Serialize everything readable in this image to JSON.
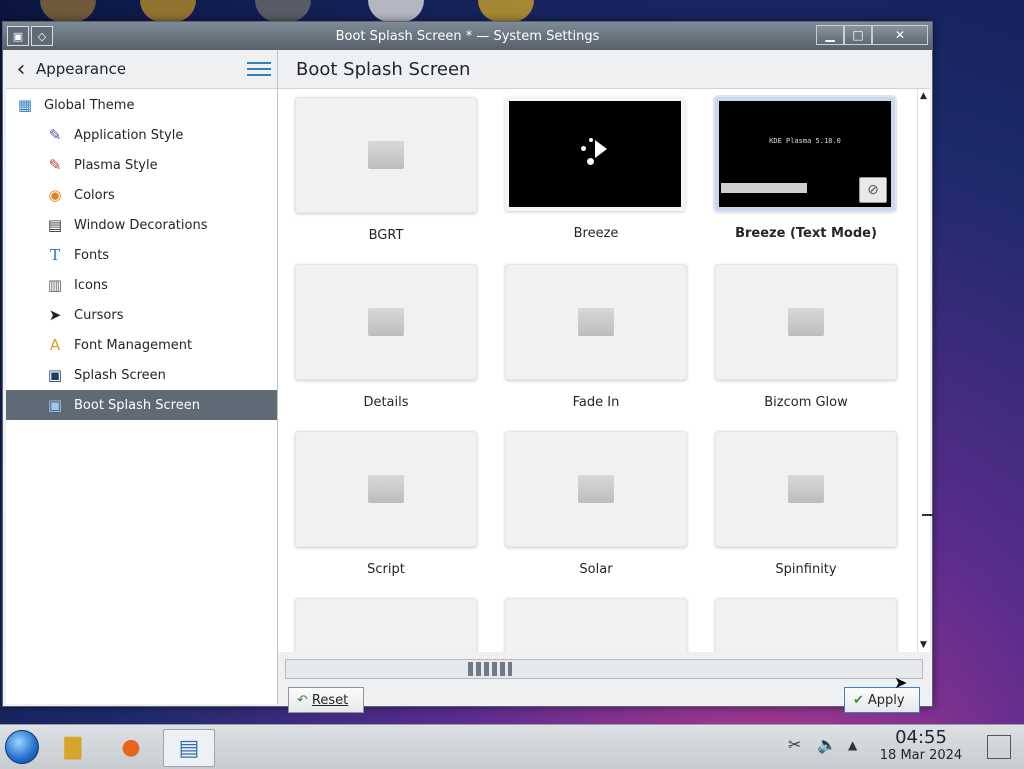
{
  "window": {
    "title": "Boot Splash Screen * — System Settings"
  },
  "sidebar": {
    "back_label": "Appearance",
    "items": [
      {
        "label": "Global Theme",
        "icon": "global-theme-icon"
      },
      {
        "label": "Application Style",
        "icon": "application-style-icon"
      },
      {
        "label": "Plasma Style",
        "icon": "plasma-style-icon"
      },
      {
        "label": "Colors",
        "icon": "colors-icon"
      },
      {
        "label": "Window Decorations",
        "icon": "window-decorations-icon"
      },
      {
        "label": "Fonts",
        "icon": "fonts-icon"
      },
      {
        "label": "Icons",
        "icon": "icons-icon"
      },
      {
        "label": "Cursors",
        "icon": "cursor-icon"
      },
      {
        "label": "Font Management",
        "icon": "font-management-icon"
      },
      {
        "label": "Splash Screen",
        "icon": "splash-screen-icon"
      },
      {
        "label": "Boot Splash Screen",
        "icon": "boot-splash-icon",
        "selected": true
      }
    ]
  },
  "main": {
    "title": "Boot Splash Screen",
    "themes": [
      {
        "label": "BGRT"
      },
      {
        "label": "Breeze"
      },
      {
        "label": "Breeze (Text Mode)",
        "preview_text": "KDE Plasma 5.18.0",
        "selected": true
      },
      {
        "label": "Details"
      },
      {
        "label": "Fade In"
      },
      {
        "label": "Bizcom Glow"
      },
      {
        "label": "Script"
      },
      {
        "label": "Solar"
      },
      {
        "label": "Spinfinity"
      }
    ]
  },
  "footer": {
    "reset_label": "Reset",
    "apply_label": "Apply"
  },
  "taskbar": {
    "time": "04:55",
    "date": "18 Mar 2024"
  },
  "colors": {
    "selection": "#5f6a76",
    "accent": "#2f7fbf"
  }
}
